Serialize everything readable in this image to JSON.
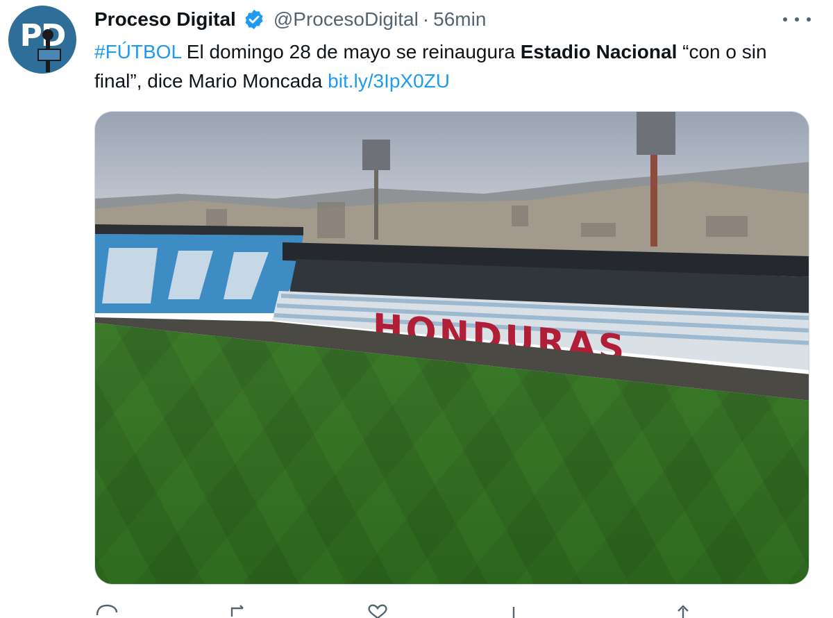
{
  "tweet": {
    "author_name": "Proceso Digital",
    "handle": "@ProcesoDigital",
    "separator": "·",
    "time": "56min",
    "avatar_text": "PD",
    "hashtag": "#FÚTBOL",
    "text_part1": " El domingo 28 de mayo se reinaugura ",
    "text_bold": "Estadio Nacional",
    "text_part2": " “con o sin final”, dice Mario Moncada ",
    "link": "bit.ly/3IpX0ZU"
  },
  "media": {
    "stand_text": "HONDURAS"
  },
  "icons": {
    "verified": "verified-badge-icon",
    "more": "more-options-icon",
    "reply": "reply-icon",
    "retweet": "retweet-icon",
    "like": "like-icon",
    "views": "views-icon",
    "share": "share-icon"
  },
  "colors": {
    "link": "#1d9bf0",
    "secondary_text": "#536471",
    "verified": "#1d9bf0"
  }
}
